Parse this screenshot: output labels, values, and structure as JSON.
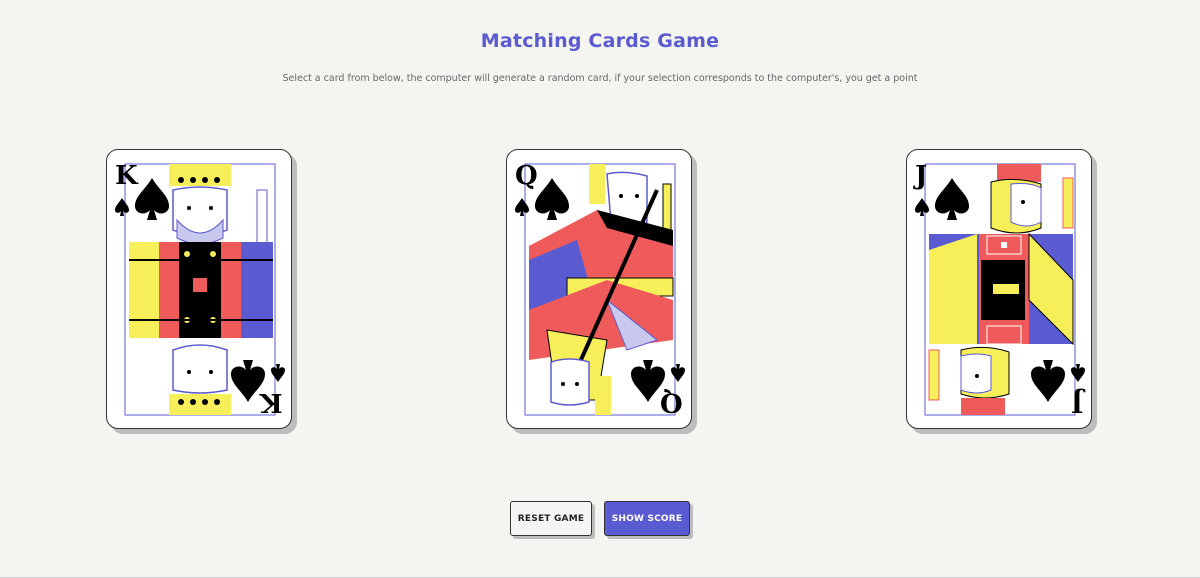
{
  "page": {
    "title": "Matching Cards Game",
    "subtitle": "Select a card from below, the computer will generate a random card, if your selection corresponds to the computer's, you get a point"
  },
  "cards": [
    {
      "rank": "K",
      "suit": "spade-icon",
      "name": "King of Spades"
    },
    {
      "rank": "Q",
      "suit": "spade-icon",
      "name": "Queen of Spades"
    },
    {
      "rank": "J",
      "suit": "spade-icon",
      "name": "Jack of Spades"
    }
  ],
  "buttons": {
    "reset_label": "RESET GAME",
    "score_label": "SHOW SCORE"
  },
  "colors": {
    "accent": "#5b5bd1",
    "background": "#f4f4f0",
    "card_red": "#ef5b5b",
    "card_yellow": "#f6ef5a",
    "card_blue": "#5b5bd1"
  }
}
